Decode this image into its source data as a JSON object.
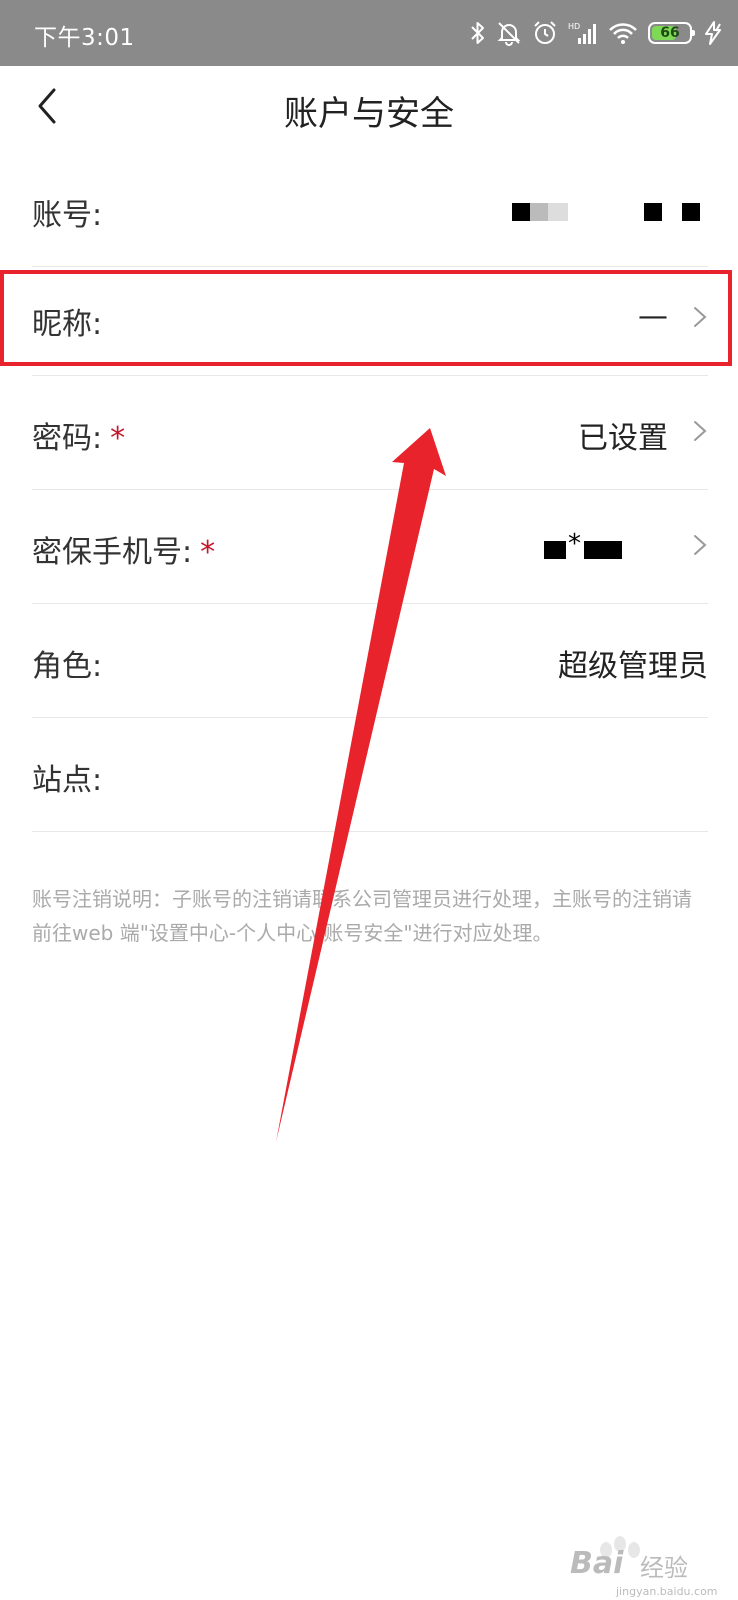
{
  "status_bar": {
    "time": "下午3:01",
    "battery_level": "66",
    "icons": [
      "bluetooth-icon",
      "mute-bell-icon",
      "alarm-icon",
      "hd-signal-icon",
      "wifi-icon",
      "battery-icon",
      "charging-icon"
    ]
  },
  "nav": {
    "title": "账户与安全",
    "back_icon": "chevron-left-icon"
  },
  "rows": [
    {
      "label": "账号:",
      "value": "",
      "required": false,
      "has_arrow": false,
      "redacted": true
    },
    {
      "label": "昵称:",
      "value": "—",
      "required": false,
      "has_arrow": true,
      "highlighted": true
    },
    {
      "label": "密码:",
      "required_mark": "*",
      "value": "已设置",
      "has_arrow": true
    },
    {
      "label": "密保手机号:",
      "required_mark": "*",
      "value": "*",
      "has_arrow": true,
      "redacted": true
    },
    {
      "label": "角色:",
      "value": "超级管理员",
      "has_arrow": false
    },
    {
      "label": "站点:",
      "value": "",
      "has_arrow": false
    }
  ],
  "note": "账号注销说明：子账号的注销请联系公司管理员进行处理，主账号的注销请前往web 端\"设置中心-个人中心-账号安全\"进行对应处理。",
  "annotation": {
    "highlight_color": "#e8232b",
    "arrow_color": "#e8232b"
  },
  "watermark": {
    "brand": "Bai",
    "brand_suffix": "经验",
    "url": "jingyan.baidu.com"
  }
}
